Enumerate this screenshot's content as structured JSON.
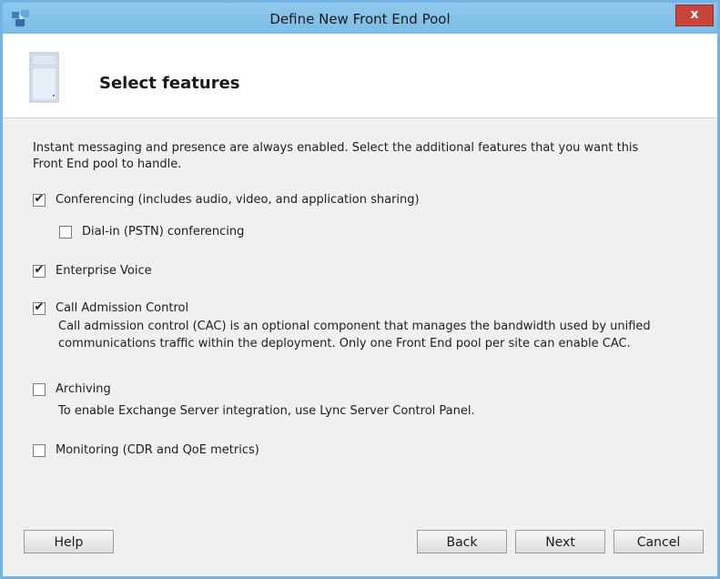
{
  "window": {
    "title": "Define New Front End Pool",
    "app_icon": "lync-setup-icon",
    "close_label": "x",
    "accent_color": "#7cbce6"
  },
  "header": {
    "icon": "server-icon",
    "title": "Select features"
  },
  "intro": {
    "line1": "Instant messaging and presence are always enabled.  Select the additional features that you want this",
    "line2": "Front End pool to handle."
  },
  "options": [
    {
      "label": "Conferencing (includes audio, video, and application sharing)",
      "checked": true
    },
    {
      "label": "Dial-in (PSTN) conferencing",
      "checked": false
    },
    {
      "label": "Enterprise Voice",
      "checked": true
    },
    {
      "label": "Call Admission Control",
      "checked": true,
      "desc1": "Call admission control (CAC) is an optional component that manages the bandwidth used by unified",
      "desc2": "communications traffic within the deployment. Only one Front End pool per site can enable CAC."
    },
    {
      "label": "Archiving",
      "checked": false,
      "desc1": "To enable Exchange Server integration, use Lync Server Control Panel."
    },
    {
      "label": "Monitoring (CDR and QoE metrics)",
      "checked": false
    }
  ],
  "check_glyph": "✔",
  "buttons": {
    "help": "Help",
    "back": "Back",
    "next": "Next",
    "cancel": "Cancel"
  }
}
